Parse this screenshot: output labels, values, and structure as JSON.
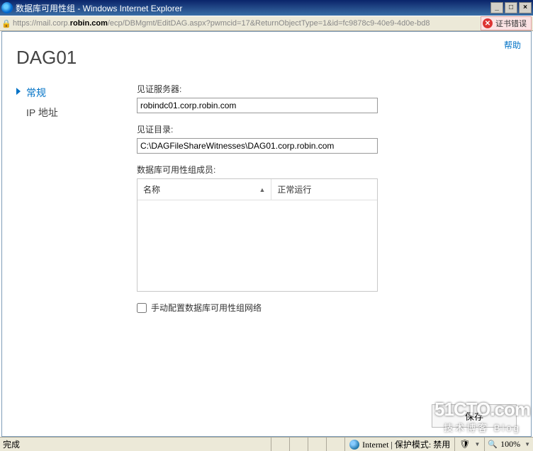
{
  "window": {
    "title": "数据库可用性组 - Windows Internet Explorer",
    "btn_min": "_",
    "btn_max": "□",
    "btn_close": "×"
  },
  "address": {
    "url_pre": "https://mail.corp.",
    "url_bold": "robin.com",
    "url_post": "/ecp/DBMgmt/EditDAG.aspx?pwmcid=17&ReturnObjectType=1&id=fc9878c9-40e9-4d0e-bd8",
    "cert_error": "证书错误"
  },
  "page": {
    "help": "帮助",
    "title": "DAG01"
  },
  "sidebar": {
    "items": [
      "常规",
      "IP 地址"
    ],
    "active": 0
  },
  "form": {
    "witness_server_label": "见证服务器:",
    "witness_server_value": "robindc01.corp.robin.com",
    "witness_dir_label": "见证目录:",
    "witness_dir_value": "C:\\DAGFileShareWitnesses\\DAG01.corp.robin.com",
    "members_label": "数据库可用性组成员:",
    "col_name": "名称",
    "col_status": "正常运行",
    "manual_net_label": "手动配置数据库可用性组网络",
    "save": "保存"
  },
  "status": {
    "done": "完成",
    "zone": "Internet | 保护模式: 禁用",
    "zoom": "100%"
  },
  "watermark": {
    "line1": "51CTO.com",
    "line2": "技术博客 Blog"
  }
}
